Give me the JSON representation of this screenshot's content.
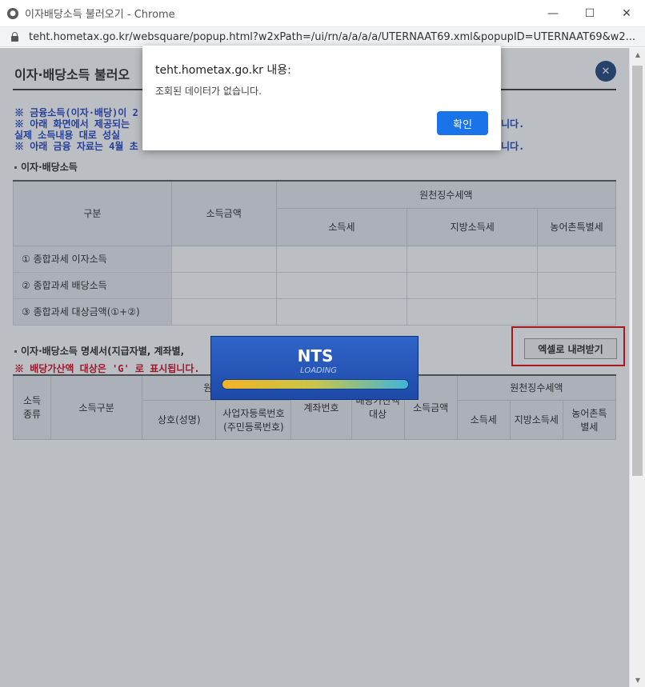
{
  "window": {
    "title": "이자배당소득 불러오기 - Chrome",
    "minimize": "—",
    "maximize": "☐",
    "close": "✕"
  },
  "urlbar": {
    "url": "teht.hometax.go.kr/websquare/popup.html?w2xPath=/ui/rn/a/a/a/a/UTERNAAT69.xml&popupID=UTERNAAT69&w2..."
  },
  "page": {
    "title": "이자·배당소득 불러오",
    "close_icon": "✕",
    "notices": [
      "※ 금융소득(이자·배당)이 2",
      "※ 아래 화면에서 제공되는",
      "   실제 소득내용 대로 성실",
      "※ 아래 금융 자료는 4월 초"
    ],
    "notices_tail": [
      "니다.",
      "니다."
    ],
    "section1_label": "이자·배당소득",
    "summary_table": {
      "headers": {
        "category": "구분",
        "income": "소득금액",
        "withholding": "원천징수세액",
        "income_tax": "소득세",
        "local_tax": "지방소득세",
        "rural_tax": "농어촌특별세"
      },
      "rows": [
        "① 종합과세 이자소득",
        "② 종합과세 배당소득",
        "③ 종합과세 대상금액(①+②)"
      ]
    },
    "section2_label": "이자·배당소득 명세서(지급자별, 계좌별,",
    "red_note": "※ 배당가산액 대상은 'G' 로 표시됩니다.",
    "excel_button": "엑셀로 내려받기",
    "detail_table": {
      "headers": {
        "income_type": "소득종류",
        "income_category": "소득구분",
        "payer_group": "원천징",
        "company_name": "상호(성명)",
        "biz_no": "사업자등록번호(주민등록번호)",
        "account_no": "계좌번호",
        "dividend_target": "배당가산액대상",
        "income_amount": "소득금액",
        "withholding": "원천징수세액",
        "income_tax": "소득세",
        "local_tax": "지방소득세",
        "rural_tax": "농어촌특별세"
      }
    }
  },
  "loading": {
    "brand": "NTS",
    "label": "LOADING"
  },
  "alert": {
    "host": "teht.hometax.go.kr 내용:",
    "message": "조회된 데이터가 없습니다.",
    "ok_label": "확인"
  }
}
